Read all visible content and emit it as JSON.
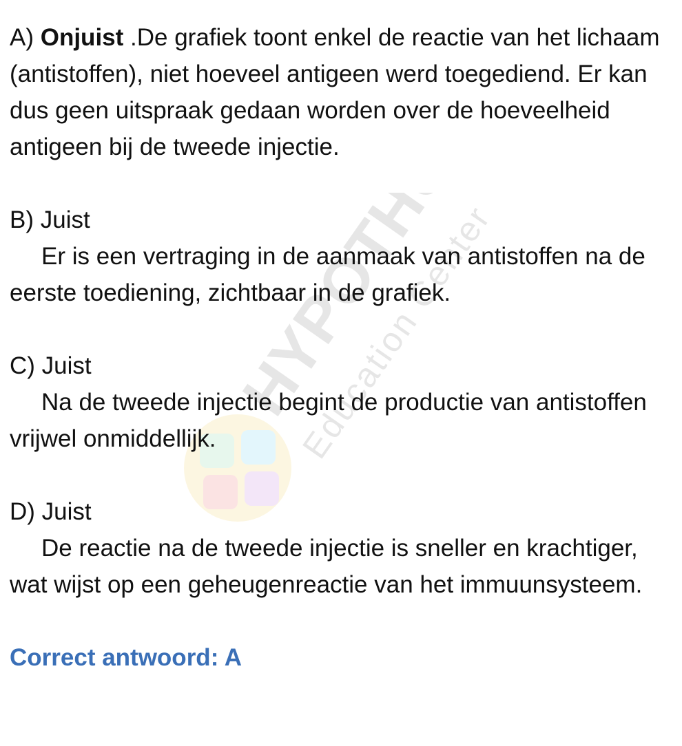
{
  "watermark": {
    "brand": "HYPOTHUSE",
    "tagline": "Education Center"
  },
  "options": [
    {
      "id": "A",
      "prefix": "A)",
      "verdict": "Onjuist",
      "text": ".De grafiek toont enkel de reactie van het lichaam (antistoffen), niet hoeveel antigeen werd toegediend. Er kan dus geen uitspraak gedaan worden over de hoeveelheid antigeen bij de tweede injectie."
    },
    {
      "id": "B",
      "heading": "B) Juist",
      "explanation": "Er is een vertraging in de aanmaak van antistoffen na de eerste toediening, zichtbaar in de grafiek."
    },
    {
      "id": "C",
      "heading": "C) Juist",
      "explanation": "Na de tweede injectie begint de productie van antistoffen vrijwel onmiddellijk."
    },
    {
      "id": "D",
      "heading": "D) Juist",
      "explanation": "De reactie na de tweede injectie is sneller en krachtiger, wat wijst op een geheugenreactie van het immuunsysteem."
    }
  ],
  "conclusion": "Correct antwoord: A",
  "colors": {
    "text": "#111111",
    "answer": "#3a6fb7"
  }
}
